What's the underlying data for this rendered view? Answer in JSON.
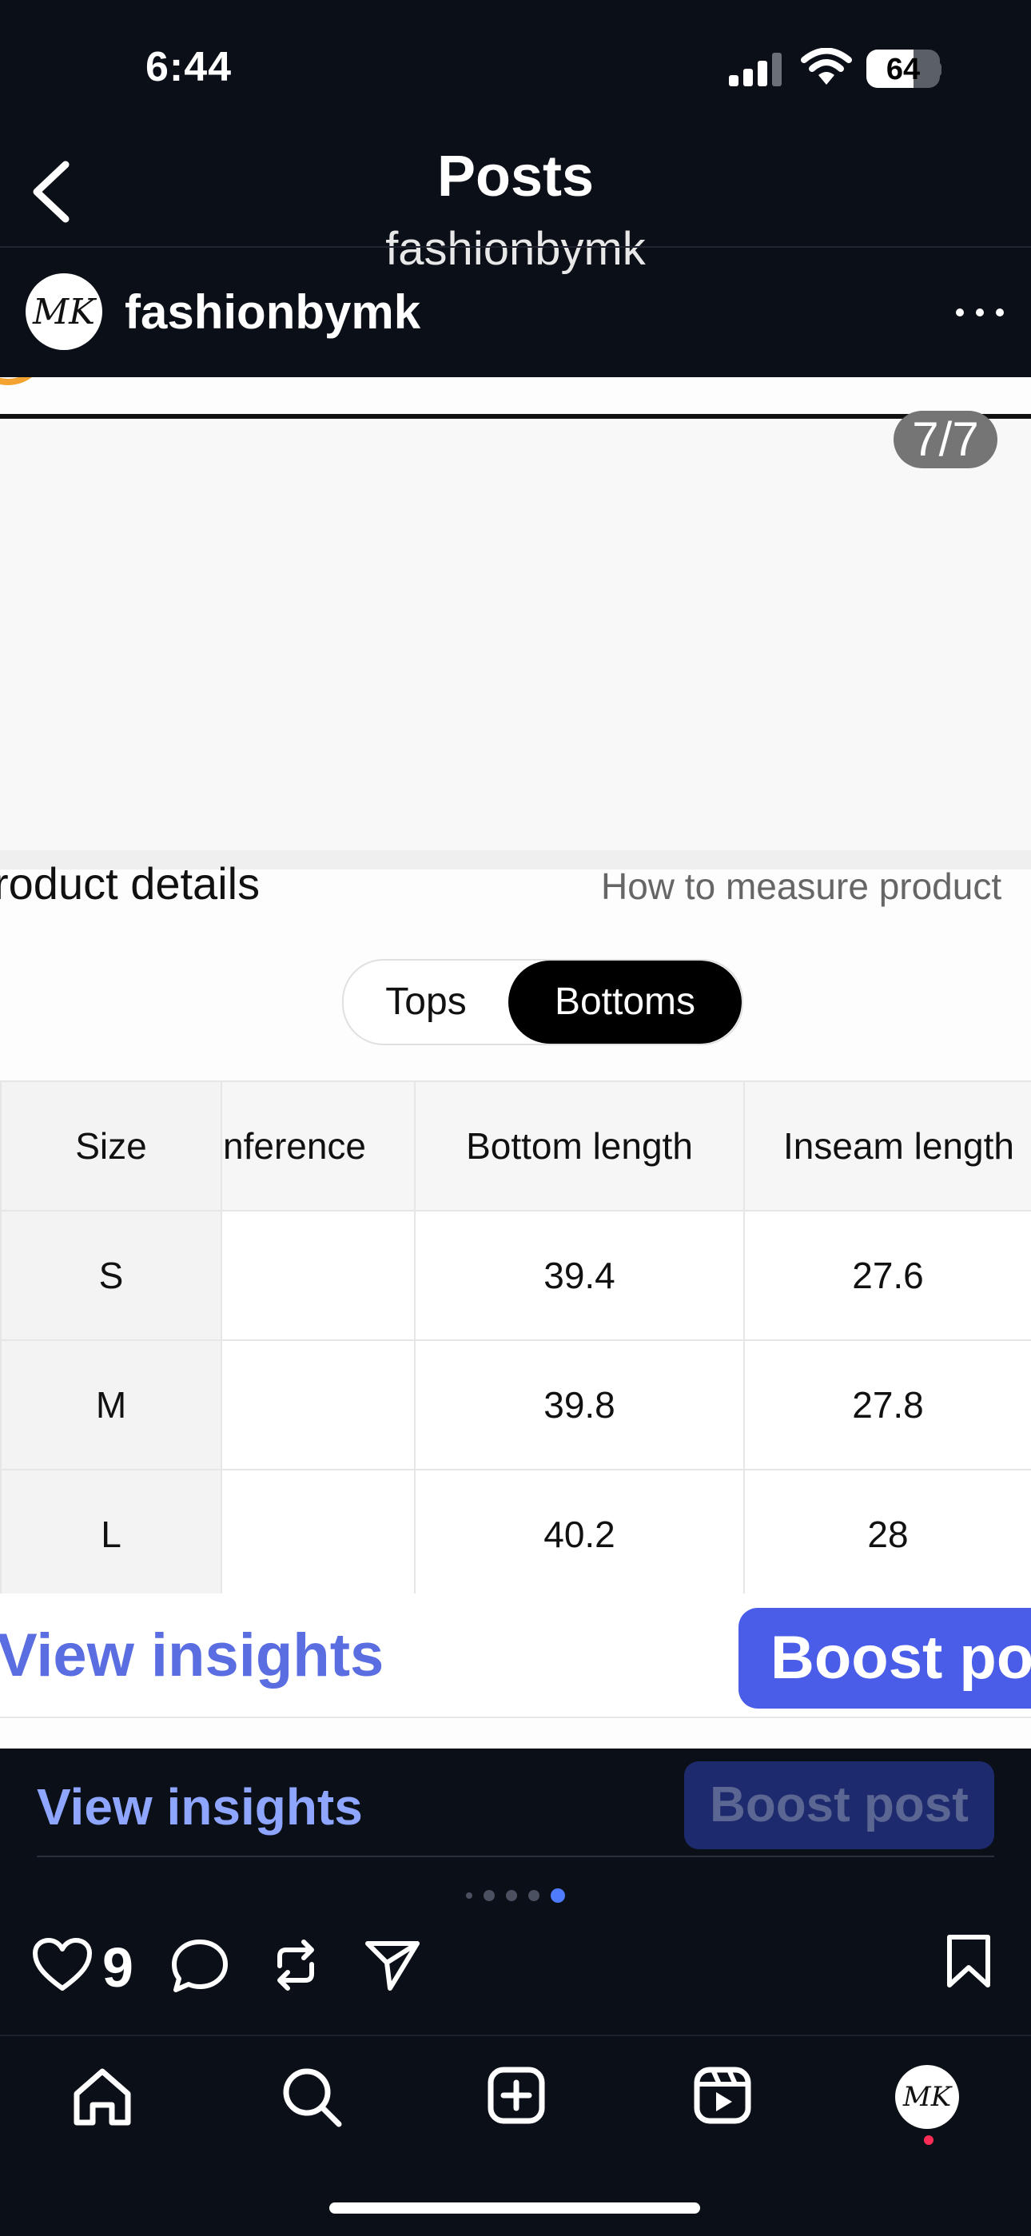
{
  "status_bar": {
    "time": "6:44",
    "battery": "64",
    "battery_level": 0.64
  },
  "nav": {
    "title": "Posts",
    "handle": "fashionbymk"
  },
  "post": {
    "username": "fashionbymk",
    "avatar_text": "MK",
    "slide_counter": "7/7"
  },
  "image_content": {
    "section_title": "roduct details",
    "measure_link": "How to measure product",
    "tabs": [
      "Tops",
      "Bottoms"
    ],
    "selected_tab": "Bottoms",
    "table": {
      "headers": [
        "Size",
        "nference",
        "Bottom length",
        "Inseam length"
      ],
      "rows": [
        [
          "S",
          "",
          "39.4",
          "27.6"
        ],
        [
          "M",
          "",
          "39.8",
          "27.8"
        ],
        [
          "L",
          "",
          "40.2",
          "28"
        ]
      ]
    },
    "view_insights": "View insights",
    "boost_post": "Boost pos"
  },
  "actions": {
    "view_insights": "View insights",
    "boost_post": "Boost post",
    "like_count": "9",
    "carousel_active_index": 4,
    "carousel_dots": 5
  },
  "tab_bar": {
    "items": [
      "home-icon",
      "search-icon",
      "create-icon",
      "reels-icon",
      "profile-avatar"
    ],
    "profile_text": "MK"
  },
  "colors": {
    "background": "#0b0f17",
    "link_blue": "#8ea6ff",
    "boost_bg": "#1e2a6e",
    "notification_red": "#ff2d55"
  }
}
